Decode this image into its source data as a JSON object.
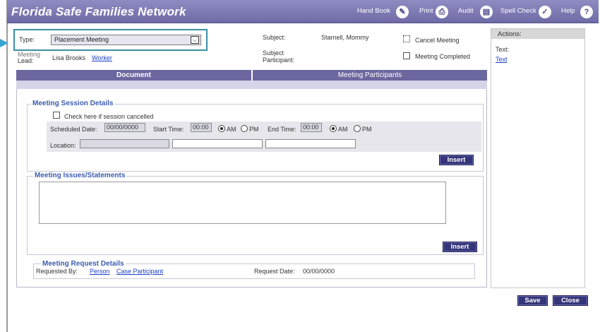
{
  "header": {
    "title": "Florida Safe Families Network",
    "items": [
      {
        "label": "Hand Book",
        "icon": "pencil-icon"
      },
      {
        "label": "Print",
        "icon": "printer-icon"
      },
      {
        "label": "Audit",
        "icon": "document-icon"
      },
      {
        "label": "Spell Check",
        "icon": "checkmark-icon"
      },
      {
        "label": "Help",
        "icon": "help-icon",
        "glyph": "?"
      }
    ]
  },
  "form": {
    "type_label": "Type:",
    "type_value": "Placement Meeting",
    "lead_label_1": "Meeting",
    "lead_label_2": "Lead:",
    "lead_name": "Lisa Brooks",
    "lead_link": "Worker",
    "subject_label": "Subject:",
    "subject_value": "Starnell, Mommy",
    "subject_participant_1": "Subject",
    "subject_participant_2": "Participant:",
    "cancel_meeting": "Cancel Meeting",
    "meeting_completed": "Meeting Completed"
  },
  "actions": {
    "heading": "Actions:",
    "text_label": "Text:",
    "text_link": "Text"
  },
  "tabs": {
    "document": "Document",
    "participants": "Meeting Participants"
  },
  "session": {
    "title": "Meeting Session Details",
    "cancelled_check": "Check here if session cancelled",
    "scheduled_date_label": "Scheduled Date:",
    "scheduled_date": "00/00/0000",
    "start_time_label": "Start Time:",
    "start_time": "00:00",
    "end_time_label": "End Time:",
    "end_time": "00:00",
    "am": "AM",
    "pm": "PM",
    "location_label": "Location:",
    "insert_button": "Insert"
  },
  "issues": {
    "title": "Meeting Issues/Statements",
    "insert_button": "Insert"
  },
  "request": {
    "title": "Meeting Request Details",
    "requested_by_label": "Requested By:",
    "person_link": "Person",
    "case_participant_link": "Case Participant",
    "request_date_label": "Request Date:",
    "request_date": "00/00/0000"
  },
  "footer": {
    "save": "Save",
    "close": "Close"
  },
  "colors": {
    "header": "#7b78b3",
    "tab": "#6b679f",
    "button": "#35357a",
    "link": "#1a3fc9",
    "highlight": "#3a8fa6"
  }
}
